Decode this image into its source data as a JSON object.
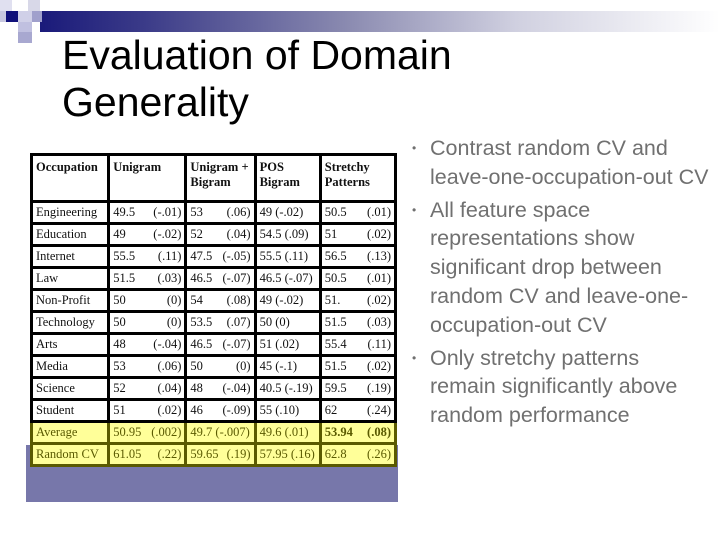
{
  "slide": {
    "title": "Evaluation of Domain Generality",
    "colors": {
      "header_bar_start": "#1a1a7a",
      "bullet_text": "#707070",
      "summary_fill": "#ffff99",
      "summary_border": "#5a5a00",
      "summary_frame": "#7777aa"
    }
  },
  "table": {
    "headers": [
      "Occupation",
      "Unigram",
      "Unigram + Bigram",
      "POS Bigram",
      "Stretchy Patterns"
    ],
    "rows": [
      {
        "occupation": "Engineering",
        "unigram": [
          "49.5",
          "(-.01)"
        ],
        "uni_bigram": [
          "53",
          "(.06)"
        ],
        "pos_bigram": "49 (-.02)",
        "stretchy": [
          "50.5",
          "(.01)"
        ]
      },
      {
        "occupation": "Education",
        "unigram": [
          "49",
          "(-.02)"
        ],
        "uni_bigram": [
          "52",
          "(.04)"
        ],
        "pos_bigram": "54.5 (.09)",
        "stretchy": [
          "51",
          "(.02)"
        ]
      },
      {
        "occupation": "Internet",
        "unigram": [
          "55.5",
          "(.11)"
        ],
        "uni_bigram": [
          "47.5",
          "(-.05)"
        ],
        "pos_bigram": "55.5 (.11)",
        "stretchy": [
          "56.5",
          "(.13)"
        ]
      },
      {
        "occupation": "Law",
        "unigram": [
          "51.5",
          "(.03)"
        ],
        "uni_bigram": [
          "46.5",
          "(-.07)"
        ],
        "pos_bigram": "46.5 (-.07)",
        "stretchy": [
          "50.5",
          "(.01)"
        ]
      },
      {
        "occupation": "Non-Profit",
        "unigram": [
          "50",
          "(0)"
        ],
        "uni_bigram": [
          "54",
          "(.08)"
        ],
        "pos_bigram": "49 (-.02)",
        "stretchy": [
          "51.",
          "(.02)"
        ]
      },
      {
        "occupation": "Technology",
        "unigram": [
          "50",
          "(0)"
        ],
        "uni_bigram": [
          "53.5",
          "(.07)"
        ],
        "pos_bigram": "50 (0)",
        "stretchy": [
          "51.5",
          "(.03)"
        ]
      },
      {
        "occupation": "Arts",
        "unigram": [
          "48",
          "(-.04)"
        ],
        "uni_bigram": [
          "46.5",
          "(-.07)"
        ],
        "pos_bigram": "51 (.02)",
        "stretchy": [
          "55.4",
          "(.11)"
        ]
      },
      {
        "occupation": "Media",
        "unigram": [
          "53",
          "(.06)"
        ],
        "uni_bigram": [
          "50",
          "(0)"
        ],
        "pos_bigram": "45 (-.1)",
        "stretchy": [
          "51.5",
          "(.02)"
        ]
      },
      {
        "occupation": "Science",
        "unigram": [
          "52",
          "(.04)"
        ],
        "uni_bigram": [
          "48",
          "(-.04)"
        ],
        "pos_bigram": "40.5 (-.19)",
        "stretchy": [
          "59.5",
          "(.19)"
        ]
      },
      {
        "occupation": "Student",
        "unigram": [
          "51",
          "(.02)"
        ],
        "uni_bigram": [
          "46",
          "(-.09)"
        ],
        "pos_bigram": "55 (.10)",
        "stretchy": [
          "62",
          "(.24)"
        ]
      }
    ],
    "summary_rows": [
      {
        "occupation": "Average",
        "unigram": [
          "50.95",
          "(.002)"
        ],
        "uni_bigram": [
          "49.7 (-.007)",
          ""
        ],
        "pos_bigram": "49.6   (.01)",
        "stretchy": [
          "53.94",
          "(.08)"
        ]
      },
      {
        "occupation": "Random CV",
        "unigram": [
          "61.05",
          "(.22)"
        ],
        "uni_bigram": [
          "59.65",
          "(.19)"
        ],
        "pos_bigram": "57.95 (.16)",
        "stretchy": [
          "62.8",
          "(.26)"
        ]
      }
    ]
  },
  "bullets": [
    "Contrast random CV and leave-one-occupation-out CV",
    "All feature space representations show significant drop between random CV and leave-one-occupation-out CV",
    "Only stretchy patterns remain significantly above random performance"
  ]
}
